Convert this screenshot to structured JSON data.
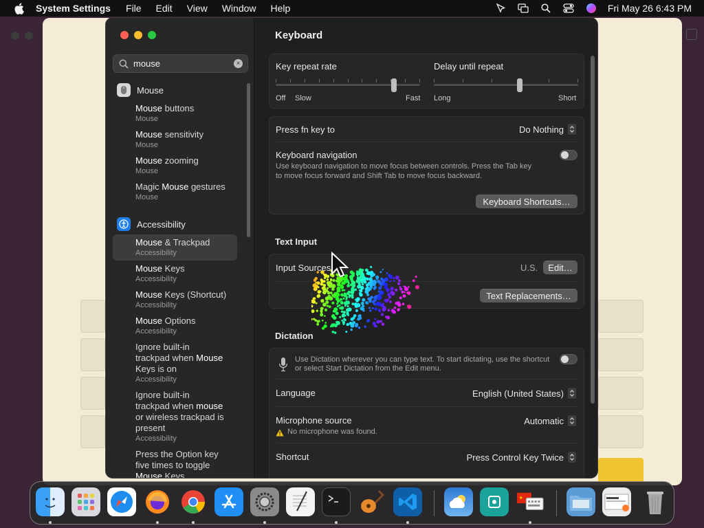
{
  "menubar": {
    "app_name": "System Settings",
    "menus": [
      "File",
      "Edit",
      "View",
      "Window",
      "Help"
    ],
    "clock": "Fri May 26  6:43 PM"
  },
  "sidebar": {
    "search_value": "mouse",
    "groups": [
      {
        "title": "Mouse",
        "icon": "mouse-icon",
        "items": [
          {
            "label": "Mouse buttons",
            "sub": "Mouse"
          },
          {
            "label": "Mouse sensitivity",
            "sub": "Mouse"
          },
          {
            "label": "Mouse zooming",
            "sub": "Mouse"
          },
          {
            "label": "Magic Mouse gestures",
            "sub": "Mouse"
          }
        ]
      },
      {
        "title": "Accessibility",
        "icon": "accessibility-icon",
        "items": [
          {
            "label": "Mouse & Trackpad",
            "sub": "Accessibility",
            "selected": true
          },
          {
            "label": "Mouse Keys",
            "sub": "Accessibility"
          },
          {
            "label": "Mouse Keys (Shortcut)",
            "sub": "Accessibility"
          },
          {
            "label": "Mouse Options",
            "sub": "Accessibility"
          },
          {
            "label": "Ignore built-in trackpad when Mouse Keys is on",
            "sub": "Accessibility"
          },
          {
            "label": "Ignore built-in trackpad when mouse or wireless trackpad is present",
            "sub": "Accessibility"
          },
          {
            "label": "Press the Option key five times to toggle Mouse Keys",
            "sub": ""
          }
        ]
      }
    ],
    "sb_lines": {
      "mouse_buttons_a": "Mouse",
      "mouse_buttons_b": " buttons",
      "mouse_sens_a": "Mouse",
      "mouse_sens_b": " sensitivity",
      "mouse_zoom_a": "Mouse",
      "mouse_zoom_b": " zooming",
      "magic_a": "Magic ",
      "magic_b": "Mouse",
      "magic_c": " gestures",
      "mt_a": "Mouse",
      "mt_b": " & Trackpad",
      "mk_a": "Mouse",
      "mk_b": " Keys",
      "mks_a": "Mouse",
      "mks_b": " Keys (Shortcut)",
      "mo_a": "Mouse",
      "mo_b": " Options",
      "ig1_l1": "Ignore built-in",
      "ig1_l2a": "trackpad when ",
      "ig1_l2b": "Mouse",
      "ig1_l3": "Keys is on",
      "ig2_l1": "Ignore built-in",
      "ig2_l2a": "trackpad when ",
      "ig2_l2b": "mouse",
      "ig2_l3": "or wireless trackpad is",
      "ig2_l4": "present",
      "opt_l1": "Press the Option key",
      "opt_l2": "five times to toggle",
      "opt_l3a": "Mouse",
      "opt_l3b": " Keys"
    },
    "subs": {
      "mouse": "Mouse",
      "acc": "Accessibility"
    }
  },
  "content": {
    "title": "Keyboard",
    "key_repeat": {
      "label": "Key repeat rate",
      "left": "Off",
      "left2": "Slow",
      "right": "Fast",
      "value_fraction": 0.83
    },
    "delay_repeat": {
      "label": "Delay until repeat",
      "left": "Long",
      "right": "Short",
      "value_fraction": 0.6
    },
    "fn_key": {
      "label": "Press fn key to",
      "value": "Do Nothing"
    },
    "kb_nav": {
      "label": "Keyboard navigation",
      "desc1": "Use keyboard navigation to move focus between controls. Press the Tab key",
      "desc2": "to move focus forward and Shift Tab to move focus backward.",
      "enabled": false
    },
    "kb_shortcuts_button": "Keyboard Shortcuts…",
    "text_input": {
      "section": "Text Input",
      "input_sources_label": "Input Sources",
      "input_sources_value": "U.S.",
      "edit_button": "Edit…",
      "text_replacements_button": "Text Replacements…"
    },
    "dictation": {
      "section": "Dictation",
      "desc1": "Use Dictation wherever you can type text. To start dictating, use the shortcut",
      "desc2": "or select Start Dictation from the Edit menu.",
      "enabled": false,
      "language_label": "Language",
      "language_value": "English (United States)",
      "mic_label": "Microphone source",
      "mic_value": "Automatic",
      "mic_warning": "No microphone was found.",
      "shortcut_label": "Shortcut",
      "shortcut_value": "Press Control Key Twice"
    }
  },
  "dock": {
    "apps": [
      "Finder",
      "Launchpad",
      "Safari",
      "Firefox",
      "Chrome",
      "App Store",
      "System Settings",
      "TextEdit",
      "Terminal",
      "GarageBand",
      "Visual Studio Code",
      "Weather",
      "Frame",
      "Input Method",
      "Downloads",
      "Preview",
      "Trash"
    ]
  },
  "colors": {
    "accent_blue": "#1f7fe8",
    "close": "#fe5f57",
    "minimize": "#febc2e",
    "zoom": "#28c840"
  }
}
